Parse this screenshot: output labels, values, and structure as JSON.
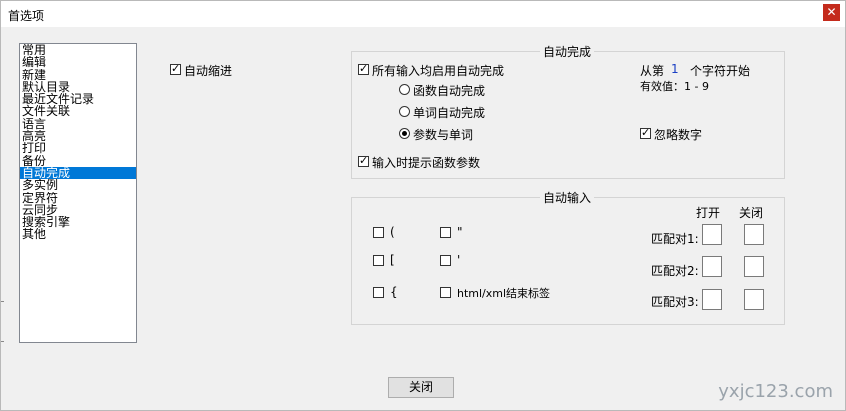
{
  "window": {
    "title": "首选项",
    "close_glyph": "✕"
  },
  "sidebar": {
    "selected_index": 10,
    "items": [
      "常用",
      "编辑",
      "新建",
      "默认目录",
      "最近文件记录",
      "文件关联",
      "语言",
      "高亮",
      "打印",
      "备份",
      "自动完成",
      "多实例",
      "定界符",
      "云同步",
      "搜索引擎",
      "其他"
    ]
  },
  "options": {
    "auto_indent": {
      "label": "自动缩进",
      "checked": true
    }
  },
  "autocomplete": {
    "title": "自动完成",
    "enable_all": {
      "label": "所有输入均启用自动完成",
      "checked": true
    },
    "radios": [
      {
        "label": "函数自动完成",
        "selected": false
      },
      {
        "label": "单词自动完成",
        "selected": false
      },
      {
        "label": "参数与单词",
        "selected": true
      }
    ],
    "start_prefix": "从第",
    "start_value": "1",
    "start_suffix": "个字符开始",
    "valid_text": "有效值：1 - 9",
    "ignore_digits": {
      "label": "忽略数字",
      "checked": true
    },
    "show_params": {
      "label": "输入时提示函数参数",
      "checked": true
    }
  },
  "autoinput": {
    "title": "自动输入",
    "pairs": [
      {
        "label": "(",
        "checked": false
      },
      {
        "label": "\"",
        "checked": false
      },
      {
        "label": "[",
        "checked": false
      },
      {
        "label": "'",
        "checked": false
      },
      {
        "label": "{",
        "checked": false
      },
      {
        "label": "html/xml结束标签",
        "checked": false
      }
    ],
    "col_open": "打开",
    "col_close": "关闭",
    "match_labels": [
      "匹配对1:",
      "匹配对2:",
      "匹配对3:"
    ]
  },
  "footer": {
    "close_button": "关闭"
  },
  "watermark": "yxjc123.com"
}
